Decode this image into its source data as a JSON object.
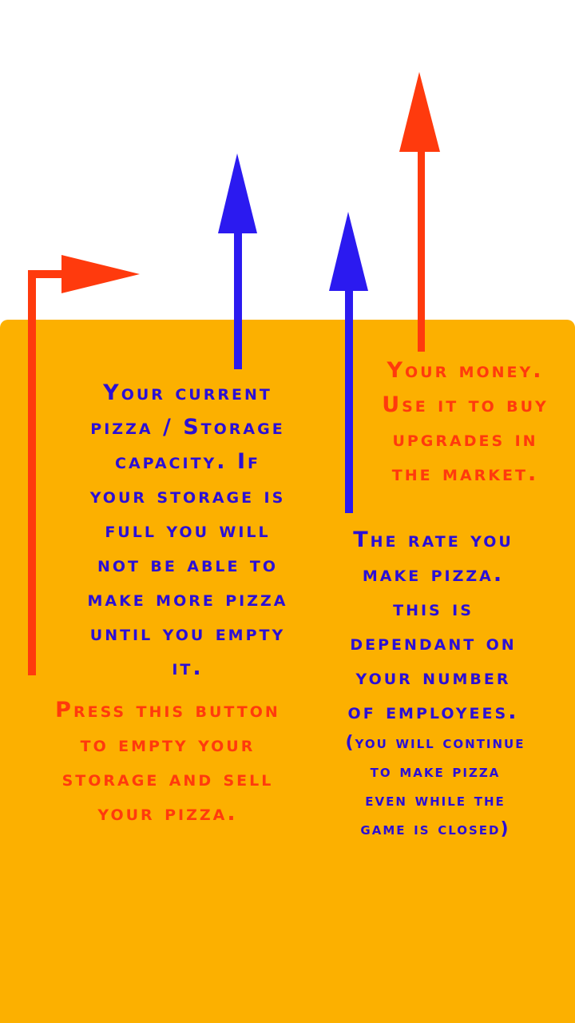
{
  "colors": {
    "panel_background": "#fcb000",
    "blue_text": "#2b0fd6",
    "red_text": "#ff3a0d",
    "blue_arrow": "#2b1af0",
    "red_arrow": "#ff3a0d"
  },
  "notes": {
    "storage": "Your current\npizza / Storage\ncapacity. If\nyour storage is\nfull you will\nnot be able to\nmake more pizza\nuntil you empty\nit.",
    "sell_button": "Press this button\nto empty your\nstorage and sell\nyour pizza.",
    "money": "Your money.\nUse it to buy\nupgrades in\nthe market.",
    "rate": "The rate you\nmake pizza.\nthis is\ndependant on\nyour number\nof employees.",
    "offline": "(you will continue\nto make pizza\neven while the\ngame is closed)"
  },
  "icons": {
    "sell_arrow": "arrow-right-icon",
    "storage_arrow": "arrow-up-icon",
    "rate_arrow": "arrow-up-icon",
    "money_arrow": "arrow-up-icon"
  }
}
